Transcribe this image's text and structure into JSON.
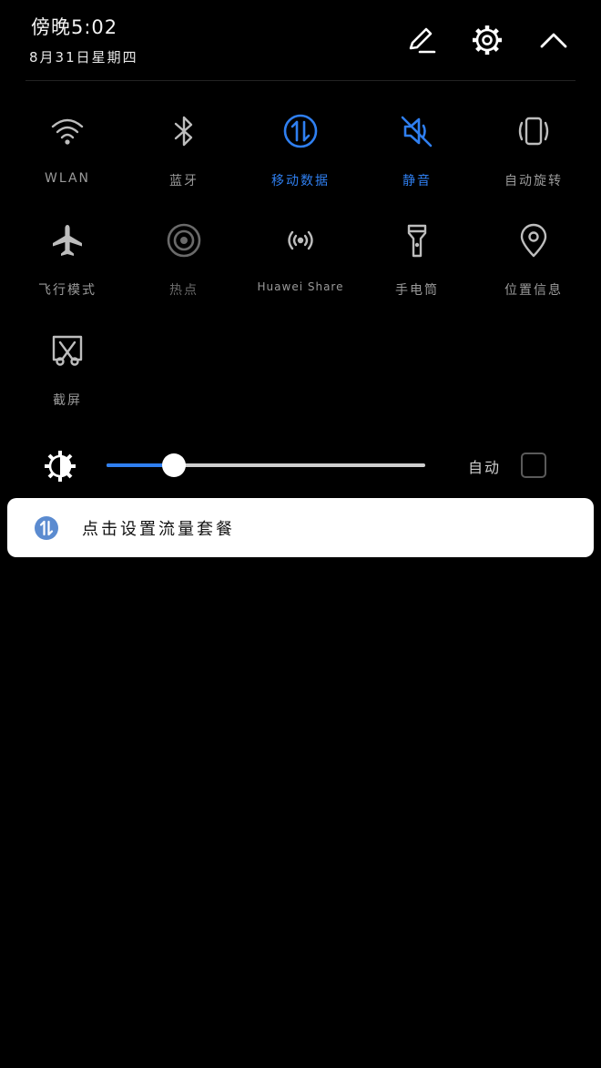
{
  "header": {
    "time": "傍晚5:02",
    "date": "8月31日星期四",
    "edit_icon": "pencil-icon",
    "settings_icon": "gear-icon",
    "collapse_icon": "chevron-up-icon"
  },
  "colors": {
    "active": "#2f7ff0",
    "inactive_icon": "#bdbdbd",
    "inactive_label": "#9a9a9a",
    "dim_icon": "#6a6a6a",
    "notif_icon_bg": "#5b8bd0"
  },
  "tiles": [
    {
      "label": "WLAN",
      "icon": "wifi-icon",
      "active": false
    },
    {
      "label": "蓝牙",
      "icon": "bluetooth-icon",
      "active": false
    },
    {
      "label": "移动数据",
      "icon": "mobile-data-icon",
      "active": true
    },
    {
      "label": "静音",
      "icon": "mute-icon",
      "active": true
    },
    {
      "label": "自动旋转",
      "icon": "rotate-icon",
      "active": false
    },
    {
      "label": "飞行模式",
      "icon": "airplane-icon",
      "active": false
    },
    {
      "label": "热点",
      "icon": "hotspot-icon",
      "active": false
    },
    {
      "label": "Huawei Share",
      "icon": "huawei-share-icon",
      "active": false
    },
    {
      "label": "手电筒",
      "icon": "flashlight-icon",
      "active": false
    },
    {
      "label": "位置信息",
      "icon": "location-icon",
      "active": false
    },
    {
      "label": "截屏",
      "icon": "screenshot-icon",
      "active": false
    }
  ],
  "brightness": {
    "level": 0.21,
    "auto_label": "自动",
    "auto_checked": false,
    "icon": "brightness-icon"
  },
  "notification": {
    "icon": "mobile-data-icon",
    "text": "点击设置流量套餐"
  }
}
